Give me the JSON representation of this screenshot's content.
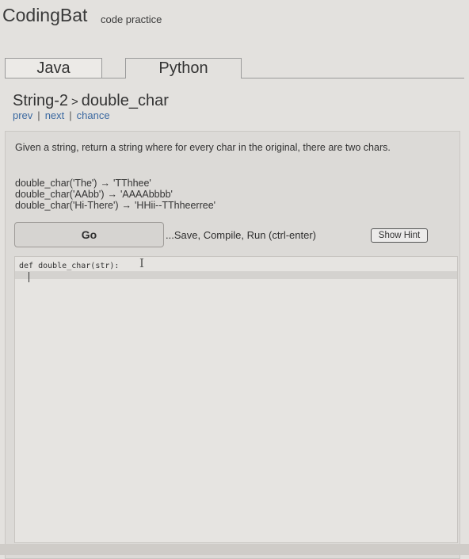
{
  "header": {
    "logo": "CodingBat",
    "tagline": "code practice"
  },
  "tabs": [
    {
      "label": "Java"
    },
    {
      "label": "Python"
    }
  ],
  "breadcrumb": {
    "section": "String-2",
    "separator": ">",
    "problem": "double_char"
  },
  "nav": {
    "prev": "prev",
    "next": "next",
    "chance": "chance",
    "pipe": "|"
  },
  "problem": {
    "description": "Given a string, return a string where for every char in the original, there are two chars.",
    "examples": [
      {
        "call": "double_char('The')",
        "arrow": "→",
        "result": "'TThhee'"
      },
      {
        "call": "double_char('AAbb')",
        "arrow": "→",
        "result": "'AAAAbbbb'"
      },
      {
        "call": "double_char('Hi-There')",
        "arrow": "→",
        "result": "'HHii--TThheerree'"
      }
    ]
  },
  "actions": {
    "go_label": "Go",
    "save_note": "...Save, Compile, Run (ctrl-enter)",
    "hint_label": "Show Hint"
  },
  "editor": {
    "code": "def double_char(str):"
  }
}
